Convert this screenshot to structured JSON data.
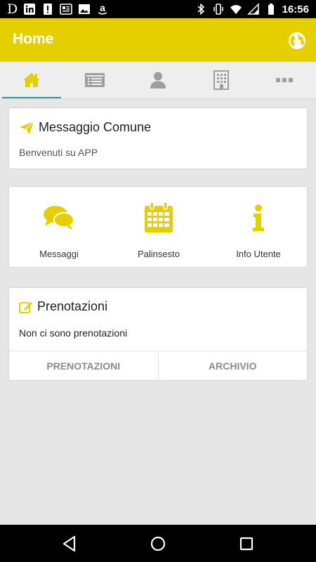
{
  "status_bar": {
    "time": "16:56",
    "left_icons": [
      "D",
      "linkedin-icon",
      "alert-icon",
      "newsletter-icon",
      "image-icon",
      "amazon-icon"
    ],
    "right_icons": [
      "bluetooth-icon",
      "vibrate-icon",
      "wifi-icon",
      "signal-icon",
      "battery-icon"
    ]
  },
  "app_bar": {
    "title": "Home",
    "accent_color": "#e5cf00"
  },
  "tabs": [
    {
      "name": "home",
      "icon": "home-icon",
      "active": true
    },
    {
      "name": "list",
      "icon": "list-icon",
      "active": false
    },
    {
      "name": "user",
      "icon": "user-icon",
      "active": false
    },
    {
      "name": "building",
      "icon": "building-icon",
      "active": false
    },
    {
      "name": "more",
      "icon": "more-icon",
      "active": false
    }
  ],
  "message_card": {
    "title": "Messaggio Comune",
    "body": "Benvenuti su APP"
  },
  "shortcuts": [
    {
      "label": "Messaggi",
      "icon": "chat-icon"
    },
    {
      "label": "Palinsesto",
      "icon": "calendar-icon"
    },
    {
      "label": "Info Utente",
      "icon": "info-icon"
    }
  ],
  "bookings_card": {
    "title": "Prenotazioni",
    "empty_text": "Non ci sono prenotazioni",
    "buttons": [
      "PRENOTAZIONI",
      "ARCHIVIO"
    ]
  },
  "colors": {
    "accent": "#e5cf00",
    "tab_icon": "#9e9e9e",
    "tab_indicator": "#2a9d8f"
  }
}
